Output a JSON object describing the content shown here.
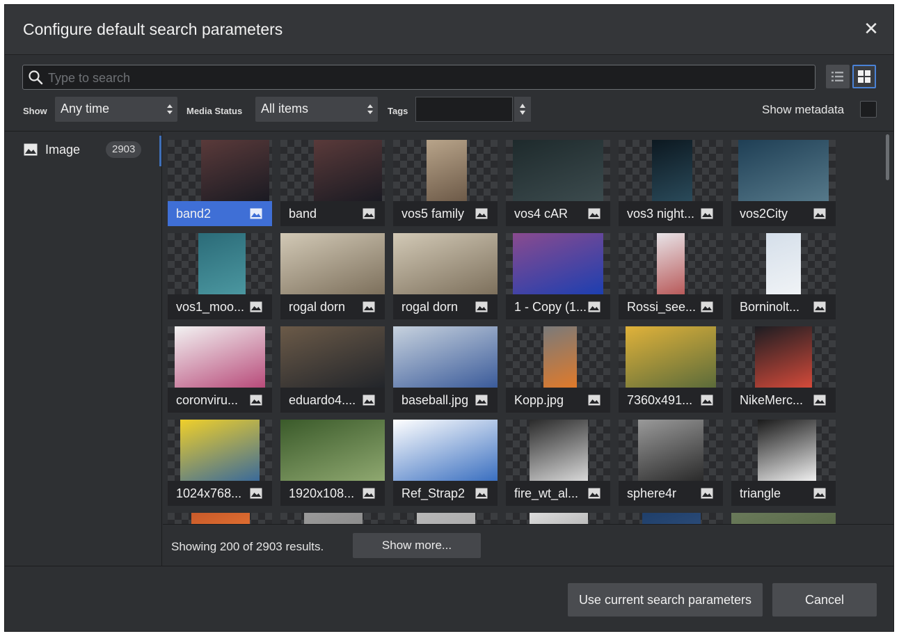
{
  "dialog": {
    "title": "Configure default search parameters"
  },
  "search": {
    "placeholder": "Type to search",
    "value": ""
  },
  "filters": {
    "show_label": "Show",
    "show_value": "Any time",
    "media_status_label": "Media Status",
    "media_status_value": "All items",
    "tags_label": "Tags",
    "tags_value": "",
    "show_metadata_label": "Show metadata"
  },
  "sidebar": {
    "items": [
      {
        "label": "Image",
        "count": "2903",
        "icon": "image-icon"
      }
    ]
  },
  "grid": {
    "items": [
      {
        "name": "band2",
        "selected": true
      },
      {
        "name": "band"
      },
      {
        "name": "vos5 family"
      },
      {
        "name": "vos4 cAR"
      },
      {
        "name": "vos3 night..."
      },
      {
        "name": "vos2City"
      },
      {
        "name": "vos1_moo..."
      },
      {
        "name": "rogal dorn"
      },
      {
        "name": "rogal dorn"
      },
      {
        "name": "1 - Copy (1..."
      },
      {
        "name": "Rossi_see..."
      },
      {
        "name": "Borninolt..."
      },
      {
        "name": "coronviru..."
      },
      {
        "name": "eduardo4...."
      },
      {
        "name": "baseball.jpg"
      },
      {
        "name": "Kopp.jpg"
      },
      {
        "name": "7360x491..."
      },
      {
        "name": "NikeMerc..."
      },
      {
        "name": "1024x768..."
      },
      {
        "name": "1920x108..."
      },
      {
        "name": "Ref_Strap2"
      },
      {
        "name": "fire_wt_al..."
      },
      {
        "name": "sphere4r"
      },
      {
        "name": "triangle"
      },
      {
        "name": ""
      },
      {
        "name": ""
      },
      {
        "name": ""
      },
      {
        "name": ""
      },
      {
        "name": ""
      },
      {
        "name": ""
      }
    ]
  },
  "footer": {
    "results_text": "Showing 200 of 2903 results.",
    "show_more_label": "Show more...",
    "use_current_label": "Use current search parameters",
    "cancel_label": "Cancel"
  },
  "colors": {
    "accent": "#3f6fd6",
    "background": "#2e3033",
    "tile": "#232427"
  }
}
